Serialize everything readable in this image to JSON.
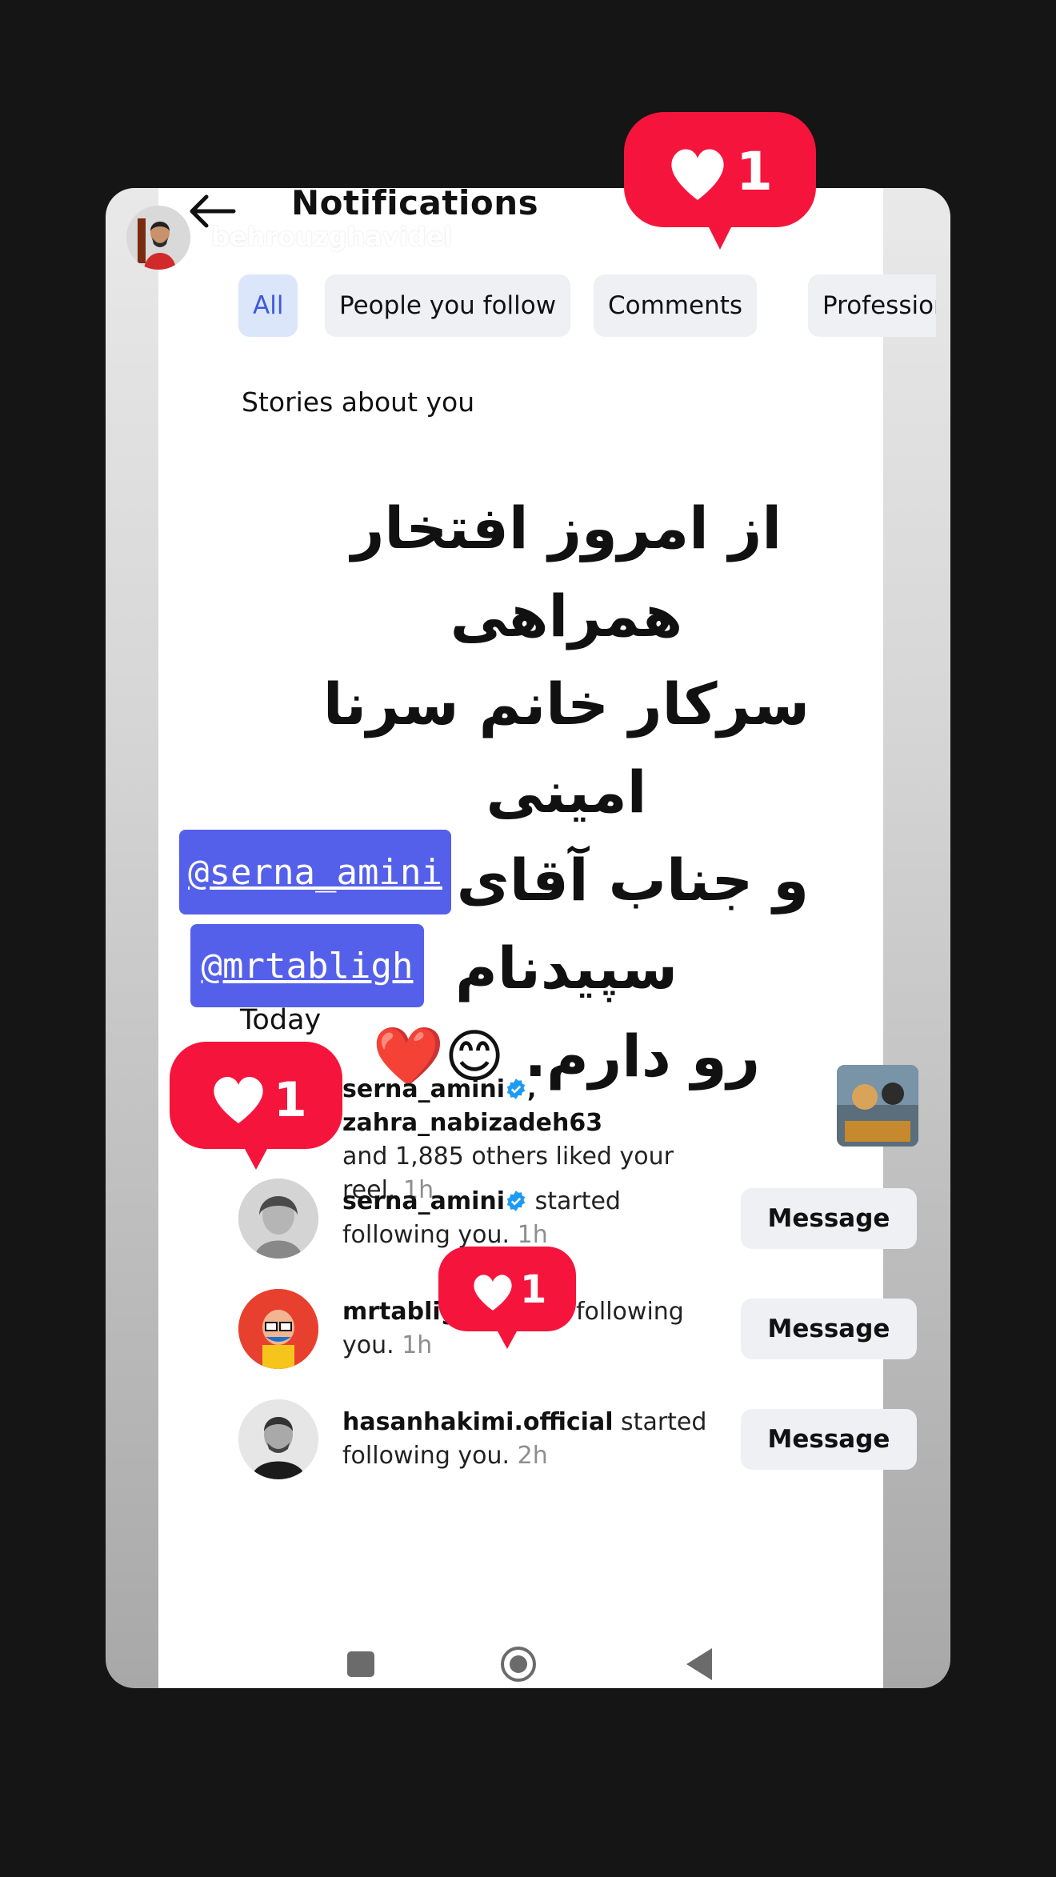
{
  "header": {
    "title": "Notifications",
    "story_username": "behrouzghavidel"
  },
  "tabs": [
    {
      "label": "All",
      "active": true
    },
    {
      "label": "People you follow",
      "active": false
    },
    {
      "label": "Comments",
      "active": false
    },
    {
      "label": "Professional",
      "active": false
    }
  ],
  "stories_section": {
    "title": "Stories about you"
  },
  "story_text": {
    "line1": "از امروز افتخار همراهی",
    "line2": "سرکار خانم سرنا امینی",
    "line3": "و جناب آقای نوید سپیدنام",
    "line4": "رو دارم.",
    "emojis": "😊❤️"
  },
  "mentions": [
    {
      "label": "@serna_amini"
    },
    {
      "label": "@mrtabligh"
    }
  ],
  "today_label": "Today",
  "notifications": [
    {
      "users": "serna_amini",
      "users2": ", zahra_nabizadeh63",
      "text": "and 1,885 others liked your reel.",
      "time": "1h"
    },
    {
      "user": "serna_amini",
      "text_a": "started",
      "text_b": "following you.",
      "time": "1h",
      "button": "Message"
    },
    {
      "user": "mrtabligh",
      "text_a": "started following",
      "text_b": "you.",
      "time": "1h",
      "button": "Message"
    },
    {
      "user": "hasanhakimi.official",
      "text_a": "started",
      "text_b": "following you.",
      "time": "2h",
      "button": "Message"
    }
  ],
  "badges": [
    {
      "count": "1"
    },
    {
      "count": "1"
    },
    {
      "count": "1"
    }
  ],
  "colors": {
    "badge_red": "#f5143c",
    "mention_blue": "#5560ea",
    "verified_blue": "#1d9bf0",
    "active_tab": "#3b5bdb"
  }
}
